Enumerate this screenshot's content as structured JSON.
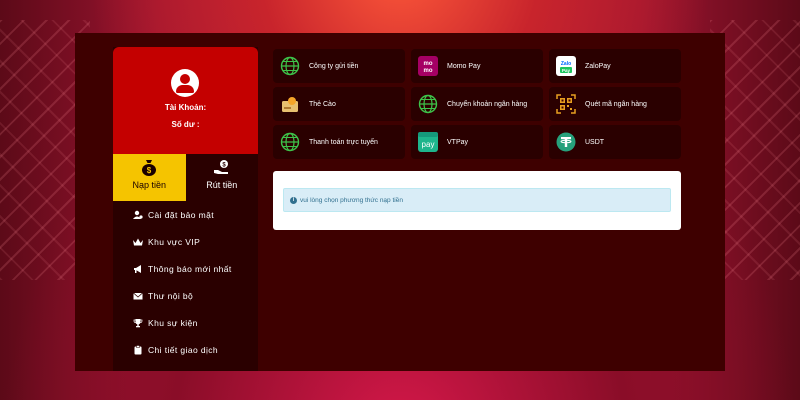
{
  "account": {
    "label": "Tài Khoản:",
    "balance_label": "Số dư :"
  },
  "tabs": [
    {
      "label": "Nạp tiền",
      "active": true
    },
    {
      "label": "Rút tiền",
      "active": false
    }
  ],
  "menu": [
    {
      "label": "Cài đặt bảo mật",
      "icon": "user-gear-icon"
    },
    {
      "label": "Khu vực VIP",
      "icon": "crown-icon"
    },
    {
      "label": "Thông báo mới nhất",
      "icon": "megaphone-icon"
    },
    {
      "label": "Thư nội bộ",
      "icon": "envelope-icon"
    },
    {
      "label": "Khu sự kiện",
      "icon": "trophy-icon"
    },
    {
      "label": "Chi tiết giao dịch",
      "icon": "clipboard-icon"
    }
  ],
  "payments": [
    {
      "label": "Công ty gửi tiền",
      "icon": "globe-icon"
    },
    {
      "label": "Momo Pay",
      "icon": "momo-icon"
    },
    {
      "label": "ZaloPay",
      "icon": "zalopay-icon"
    },
    {
      "label": "Thẻ Cào",
      "icon": "scratch-card-icon"
    },
    {
      "label": "Chuyển khoản ngân hàng",
      "icon": "globe-icon"
    },
    {
      "label": "Quét mã ngân hàng",
      "icon": "qr-code-icon"
    },
    {
      "label": "Thanh toán trực tuyến",
      "icon": "globe-icon"
    },
    {
      "label": "VTPay",
      "icon": "vtpay-icon"
    },
    {
      "label": "USDT",
      "icon": "usdt-icon"
    }
  ],
  "alert": {
    "text": "vui lòng chọn phương thức nạp tiền"
  },
  "colors": {
    "panel": "#3e0000",
    "profile": "#c40000",
    "active_tab": "#f5c400",
    "button": "#2a0000"
  }
}
